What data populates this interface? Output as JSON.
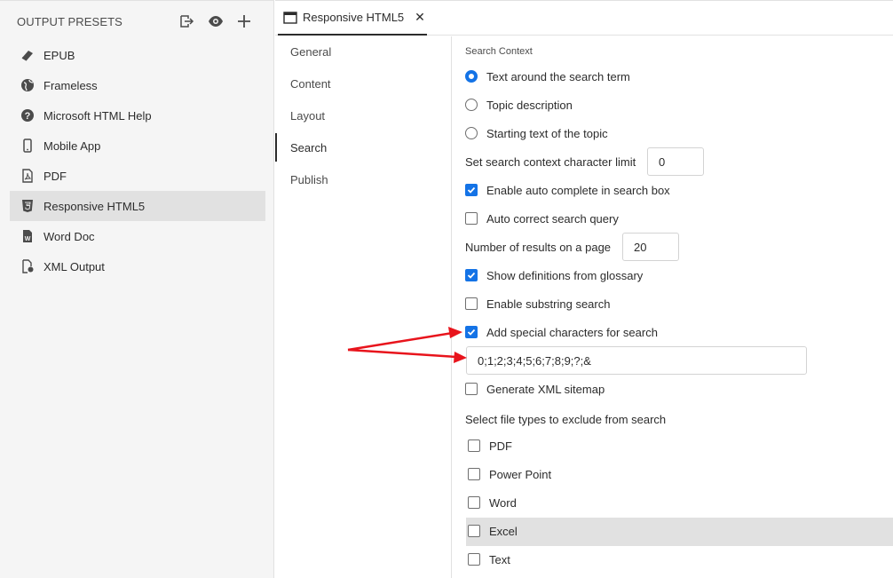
{
  "sidebar": {
    "title": "OUTPUT PRESETS",
    "header_icons": [
      "export-icon",
      "preview-eye-icon",
      "add-plus-icon"
    ],
    "presets": [
      {
        "label": "EPUB",
        "icon": "epub-icon"
      },
      {
        "label": "Frameless",
        "icon": "globe-icon"
      },
      {
        "label": "Microsoft HTML Help",
        "icon": "help-circle-icon"
      },
      {
        "label": "Mobile App",
        "icon": "mobile-icon"
      },
      {
        "label": "PDF",
        "icon": "pdf-icon"
      },
      {
        "label": "Responsive HTML5",
        "icon": "html5-icon",
        "active": true
      },
      {
        "label": "Word Doc",
        "icon": "word-doc-icon"
      },
      {
        "label": "XML Output",
        "icon": "xml-output-icon"
      }
    ]
  },
  "tabs": [
    {
      "label": "Responsive HTML5",
      "close": "✕"
    }
  ],
  "nav": {
    "items": [
      "General",
      "Content",
      "Layout",
      "Search",
      "Publish"
    ],
    "active": "Search"
  },
  "search": {
    "context_label": "Search Context",
    "radio_text_around": "Text around the search term",
    "radio_topic_desc": "Topic description",
    "radio_starting_text": "Starting text of the topic",
    "char_limit_label": "Set search context character limit",
    "char_limit_value": "0",
    "autocomplete_label": "Enable auto complete in search box",
    "autocorrect_label": "Auto correct search query",
    "results_label": "Number of results on a page",
    "results_value": "20",
    "glossary_label": "Show definitions from glossary",
    "substring_label": "Enable substring search",
    "special_chars_label": "Add special characters for search",
    "special_chars_value": "0;1;2;3;4;5;6;7;8;9;?;&",
    "sitemap_label": "Generate XML sitemap",
    "exclude_label": "Select file types to exclude from search",
    "file_types": [
      "PDF",
      "Power Point",
      "Word",
      "Excel",
      "Text"
    ]
  },
  "colors": {
    "accent": "#1473e6",
    "annotation_arrow": "#e8141c",
    "selected_bg": "#e1e1e1"
  }
}
